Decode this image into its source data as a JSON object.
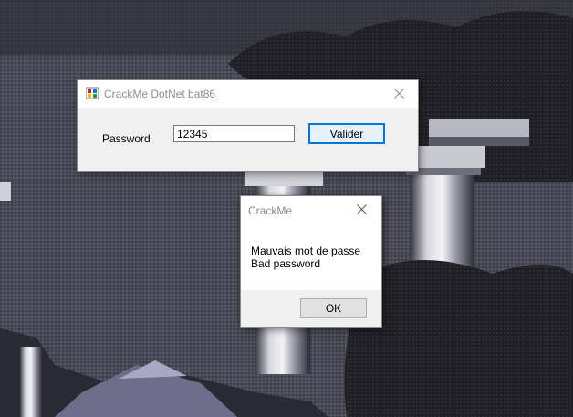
{
  "main_window": {
    "title": "CrackMe DotNet bat86",
    "password_label": "Password",
    "password_value": "12345",
    "validate_label": "Valider"
  },
  "message_box": {
    "title": "CrackMe",
    "line1": "Mauvais mot de passe",
    "line2": "Bad password",
    "ok_label": "OK"
  },
  "colors": {
    "accent": "#0078d7",
    "window_bg": "#f0f0f0",
    "titlebar_bg": "#ffffff"
  },
  "icons": {
    "app": "app-icon",
    "close": "close-icon"
  }
}
